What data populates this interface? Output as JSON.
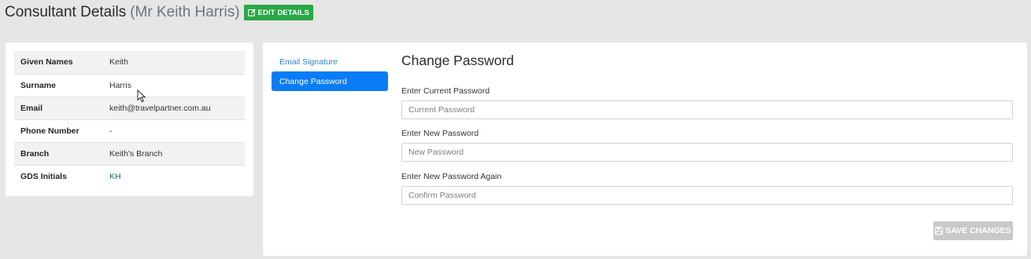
{
  "header": {
    "title": "Consultant Details",
    "subtitle": "(Mr Keith Harris)",
    "edit_button_label": "EDIT DETAILS",
    "edit_button_icon": "edit-icon"
  },
  "details": {
    "rows": [
      {
        "label": "Given Names",
        "value": "Keith"
      },
      {
        "label": "Surname",
        "value": "Harris"
      },
      {
        "label": "Email",
        "value": "keith@travelpartner.com.au"
      },
      {
        "label": "Phone Number",
        "value": "-"
      },
      {
        "label": "Branch",
        "value": "Keith's Branch"
      },
      {
        "label": "GDS Initials",
        "value": "KH"
      }
    ]
  },
  "side_nav": {
    "items": [
      {
        "label": "Email Signature",
        "active": false
      },
      {
        "label": "Change Password",
        "active": true
      }
    ]
  },
  "form": {
    "title": "Change Password",
    "current": {
      "label": "Enter Current Password",
      "placeholder": "Current Password",
      "value": ""
    },
    "new": {
      "label": "Enter New Password",
      "placeholder": "New Password",
      "value": ""
    },
    "confirm": {
      "label": "Enter New Password Again",
      "placeholder": "Confirm Password",
      "value": ""
    },
    "save_label": "SAVE CHANGES",
    "save_icon": "save-icon"
  },
  "colors": {
    "background": "#e5e6e5",
    "edit_button": "#28a745",
    "active_nav": "#0a7cf5",
    "link": "#2f7fcf",
    "save_disabled": "#c8c9ca"
  }
}
